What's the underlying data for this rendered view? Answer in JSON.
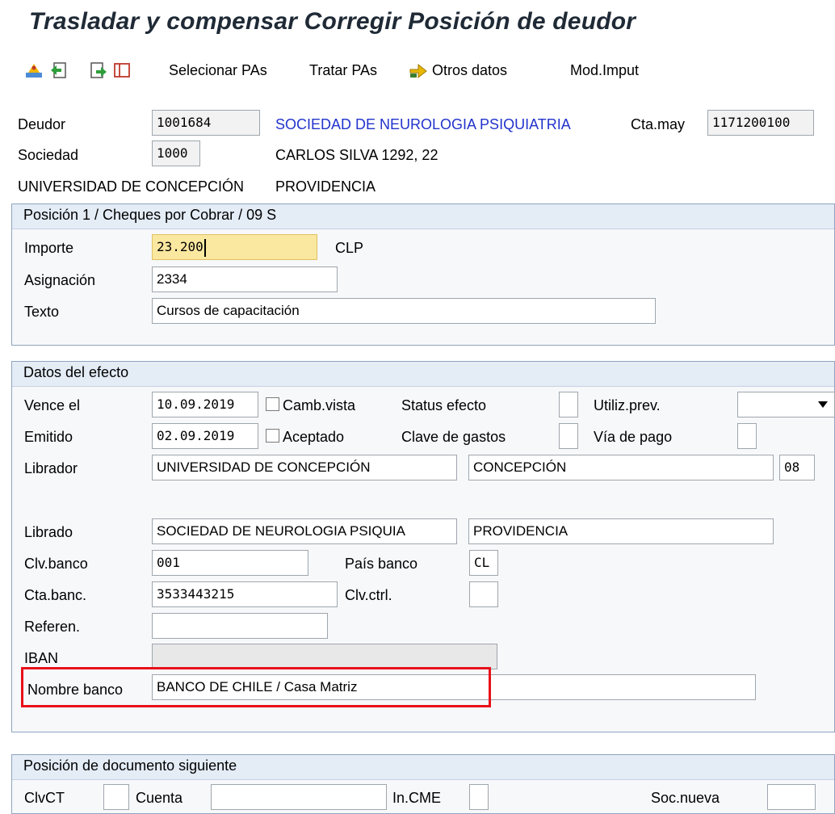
{
  "window": {
    "title": "Trasladar y compensar Corregir Posición de deudor"
  },
  "toolbar": {
    "icons": [
      "tree-icon",
      "back-arrow-icon",
      "forward-arrow-icon",
      "split-window-icon",
      "other-data-arrow-icon"
    ],
    "seleccionar": "Selecionar PAs",
    "tratar": "Tratar PAs",
    "otros": "Otros datos",
    "modimput": "Mod.Imput"
  },
  "header": {
    "deudor_label": "Deudor",
    "deudor_value": "1001684",
    "deudor_name": "SOCIEDAD DE NEUROLOGIA PSIQUIATRIA",
    "ctamay_label": "Cta.may",
    "ctamay_value": "1171200100",
    "sociedad_label": "Sociedad",
    "sociedad_value": "1000",
    "address": "CARLOS SILVA 1292, 22",
    "company_name": "UNIVERSIDAD DE CONCEPCIÓN",
    "city": "PROVIDENCIA"
  },
  "posicion": {
    "title": "Posición 1 / Cheques por Cobrar / 09 S",
    "importe_label": "Importe",
    "importe_value": "23.200",
    "currency": "CLP",
    "asignacion_label": "Asignación",
    "asignacion_value": "2334",
    "texto_label": "Texto",
    "texto_value": "Cursos de capacitación"
  },
  "efecto": {
    "title": "Datos del efecto",
    "vence_label": "Vence el",
    "vence_value": "10.09.2019",
    "camb_vista": "Camb.vista",
    "status_label": "Status efecto",
    "utiliz_label": "Utiliz.prev.",
    "emitido_label": "Emitido",
    "emitido_value": "02.09.2019",
    "aceptado": "Aceptado",
    "clave_label": "Clave de gastos",
    "via_label": "Vía de pago",
    "librador_label": "Librador",
    "librador_name": "UNIVERSIDAD DE CONCEPCIÓN",
    "librador_city": "CONCEPCIÓN",
    "librador_region": "08",
    "librado_label": "Librado",
    "librado_name": "SOCIEDAD DE NEUROLOGIA PSIQUIA",
    "librado_city": "PROVIDENCIA",
    "clvbanco_label": "Clv.banco",
    "clvbanco_value": "001",
    "paisbanco_label": "País banco",
    "paisbanco_value": "CL",
    "ctabanc_label": "Cta.banc.",
    "ctabanc_value": "3533443215",
    "clvctrl_label": "Clv.ctrl.",
    "referen_label": "Referen.",
    "iban_label": "IBAN",
    "nombre_label": "Nombre banco",
    "nombre_value": "BANCO DE CHILE / Casa Matriz"
  },
  "siguiente": {
    "title": "Posición de documento siguiente",
    "clvct_label": "ClvCT",
    "cuenta_label": "Cuenta",
    "incme_label": "In.CME",
    "socnueva_label": "Soc.nueva"
  },
  "colors": {
    "highlight_border": "#e8101a",
    "link_text": "#2233cc",
    "input_focus": "#fbe8a0"
  }
}
